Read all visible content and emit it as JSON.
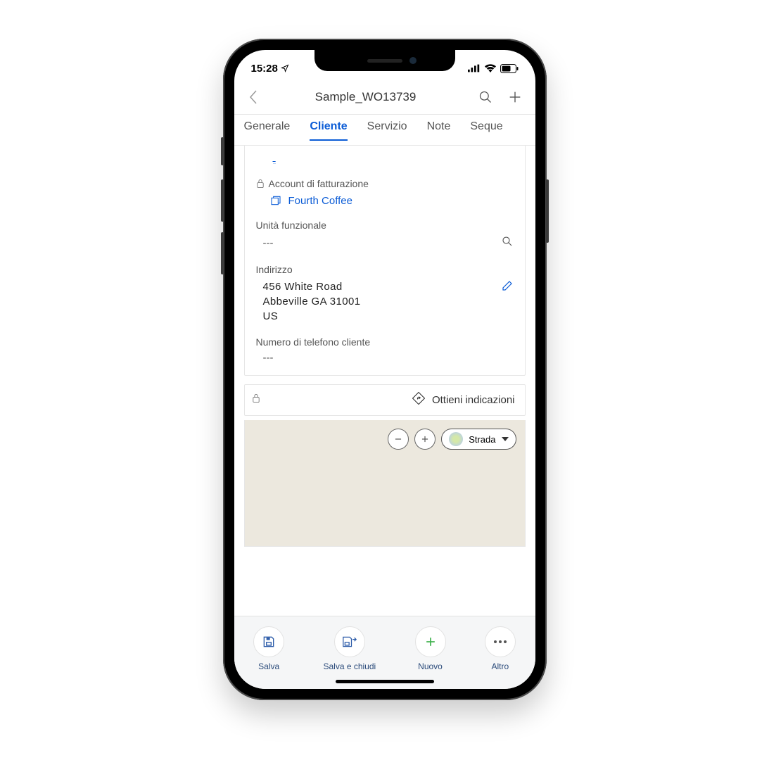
{
  "status": {
    "time": "15:28"
  },
  "header": {
    "title": "Sample_WO13739"
  },
  "tabs": [
    {
      "label": "Generale",
      "active": false
    },
    {
      "label": "Cliente",
      "active": true
    },
    {
      "label": "Servizio",
      "active": false
    },
    {
      "label": "Note",
      "active": false
    },
    {
      "label": "Seque",
      "active": false
    }
  ],
  "form": {
    "account_fatturazione": {
      "label": "Account di fatturazione",
      "value": "Fourth Coffee",
      "locked": true
    },
    "unita_funzionale": {
      "label": "Unità funzionale",
      "value": "---"
    },
    "indirizzo": {
      "label": "Indirizzo",
      "line1": "456 White Road",
      "line2": "Abbeville GA 31001",
      "line3": "US"
    },
    "telefono": {
      "label": "Numero di telefono cliente",
      "value": "---"
    }
  },
  "directions": {
    "label": "Ottieni indicazioni"
  },
  "map": {
    "type_label": "Strada"
  },
  "bottombar": {
    "save": "Salva",
    "save_close": "Salva e chiudi",
    "new": "Nuovo",
    "more": "Altro"
  }
}
